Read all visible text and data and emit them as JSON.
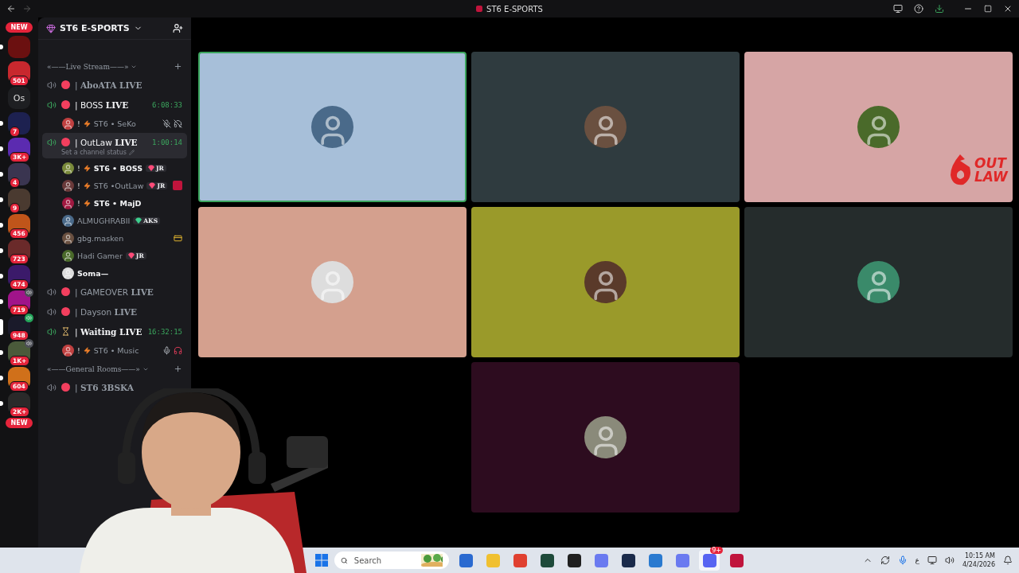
{
  "title_bar": {
    "title": "ST6 E-SPORTS"
  },
  "rail": [
    {
      "kind": "new",
      "text": "NEW"
    },
    {
      "kind": "icon",
      "color": "#6b1010",
      "unread": true
    },
    {
      "kind": "icon",
      "color": "#c8282e",
      "count": "501",
      "unread": false
    },
    {
      "kind": "text",
      "text": "Os"
    },
    {
      "kind": "icon",
      "color": "#1d2150",
      "count": "7",
      "unread": true
    },
    {
      "kind": "icon",
      "color": "#5b2bb0",
      "count": "3K+",
      "unread": true
    },
    {
      "kind": "icon",
      "color": "#3a3550",
      "count": "4",
      "unread": true
    },
    {
      "kind": "icon",
      "color": "#4a3a30",
      "count": "9",
      "unread": true
    },
    {
      "kind": "icon",
      "color": "#c0551a",
      "count": "456",
      "unread": true
    },
    {
      "kind": "icon",
      "color": "#6a2a2a",
      "count": "723",
      "unread": true
    },
    {
      "kind": "icon",
      "color": "#3b1a6a",
      "count": "474",
      "unread": true
    },
    {
      "kind": "icon",
      "color": "#a0148a",
      "count": "719",
      "unread": true,
      "in_voice": true,
      "voice_live": false
    },
    {
      "kind": "icon",
      "color": "#1a1a2a",
      "count": "948",
      "unread": false,
      "selected": true,
      "in_voice": true,
      "voice_live": true
    },
    {
      "kind": "icon",
      "color": "#4a5a3a",
      "count": "1K+",
      "unread": true,
      "in_voice": true,
      "voice_live": false
    },
    {
      "kind": "icon",
      "color": "#d0701a",
      "count": "604",
      "unread": true
    },
    {
      "kind": "icon",
      "color": "#2a2a2a",
      "count": "2K+",
      "unread": true
    },
    {
      "kind": "new",
      "text": "NEW"
    }
  ],
  "server": {
    "name": "ST6 E-SPORTS"
  },
  "sections": [
    {
      "kind": "category",
      "name": "«——Live Stream——»"
    },
    {
      "kind": "channel",
      "name": "| **AboATA LIVE**",
      "active": false,
      "hourglass": false,
      "selected": false
    },
    {
      "kind": "channel",
      "name": "| BOSS **LIVE**",
      "active": true,
      "hourglass": false,
      "timer": "6:08:33",
      "selected": false
    },
    {
      "kind": "member",
      "prefix": "!",
      "name": "ST6 • SeKo",
      "bold": false,
      "mic_muted": true,
      "deafened": true
    },
    {
      "kind": "channel",
      "name": "| OutLaw **LIVE**",
      "active": true,
      "hourglass": false,
      "timer": "1:00:14",
      "selected": true,
      "status": "Set a channel status"
    },
    {
      "kind": "member",
      "prefix": "!",
      "name": "ST6 • BOSS",
      "bold": true,
      "badge": {
        "text": "JR",
        "color": "#ff4d7a"
      }
    },
    {
      "kind": "member",
      "prefix": "!",
      "name": "ST6 •OutLaw",
      "bold": false,
      "badge": {
        "text": "JR",
        "color": "#ff4d7a"
      },
      "app": true
    },
    {
      "kind": "member",
      "prefix": "!",
      "name": "ST6 • MajD",
      "bold": true
    },
    {
      "kind": "member",
      "name": "ALMUGHRABII",
      "bold": false,
      "badge": {
        "text": "AKS",
        "color": "#3ecf8e"
      }
    },
    {
      "kind": "member",
      "name": "gbg.masken",
      "bold": false,
      "card": true
    },
    {
      "kind": "member",
      "name": "Hadi Gamer",
      "bold": false,
      "badge": {
        "text": "JR",
        "color": "#ff4d7a"
      }
    },
    {
      "kind": "member",
      "name": "Soma—",
      "bold": true
    },
    {
      "kind": "channel",
      "name": "| GAMEOVER **LIVE**",
      "active": false,
      "hourglass": false,
      "selected": false
    },
    {
      "kind": "channel",
      "name": "| Dayson **LIVE**",
      "active": false,
      "hourglass": false,
      "selected": false
    },
    {
      "kind": "channel",
      "name": "| **Waiting LIVE**",
      "active": true,
      "hourglass": true,
      "timer": "16:32:15",
      "selected": false
    },
    {
      "kind": "member",
      "prefix": "!",
      "name": "ST6 • Music",
      "bold": false,
      "mic": true,
      "headset": true
    },
    {
      "kind": "category",
      "name": "«——General Rooms——»"
    },
    {
      "kind": "channel",
      "name": "| **ST6 3BSKA**",
      "active": false,
      "hourglass": false,
      "selected": false
    }
  ],
  "tiles": [
    {
      "color": "#a7bfd9",
      "speaking": true
    },
    {
      "color": "#2f3b3f",
      "speaking": false
    },
    {
      "color": "#d6a5a5",
      "speaking": false
    },
    {
      "color": "#d4a08e",
      "speaking": false
    },
    {
      "color": "#9a9a2a",
      "speaking": false
    },
    {
      "color": "#252c2c",
      "speaking": false
    },
    {
      "color": "#2d0c1f",
      "speaking": false
    }
  ],
  "logo": {
    "top": "OUT",
    "bottom": "LAW"
  },
  "taskbar": {
    "search": {
      "placeholder": "Search"
    },
    "apps": [
      {
        "color": "#2a6ad0",
        "selected": false
      },
      {
        "color": "#f0c030",
        "selected": false
      },
      {
        "color": "#e04030",
        "selected": false
      },
      {
        "color": "#1e4a3a",
        "selected": false
      },
      {
        "color": "#202020",
        "selected": false
      },
      {
        "color": "#6a7af0",
        "selected": false
      },
      {
        "color": "#1a2a4a",
        "selected": false
      },
      {
        "color": "#2a7ad0",
        "selected": false
      },
      {
        "color": "#6a7af0",
        "selected": false
      },
      {
        "color": "#5865f2",
        "selected": true,
        "badge": "9+"
      },
      {
        "color": "#c0143c",
        "selected": false
      }
    ],
    "language": "ع",
    "time": "10:15 AM",
    "date": "4/24/2026"
  }
}
